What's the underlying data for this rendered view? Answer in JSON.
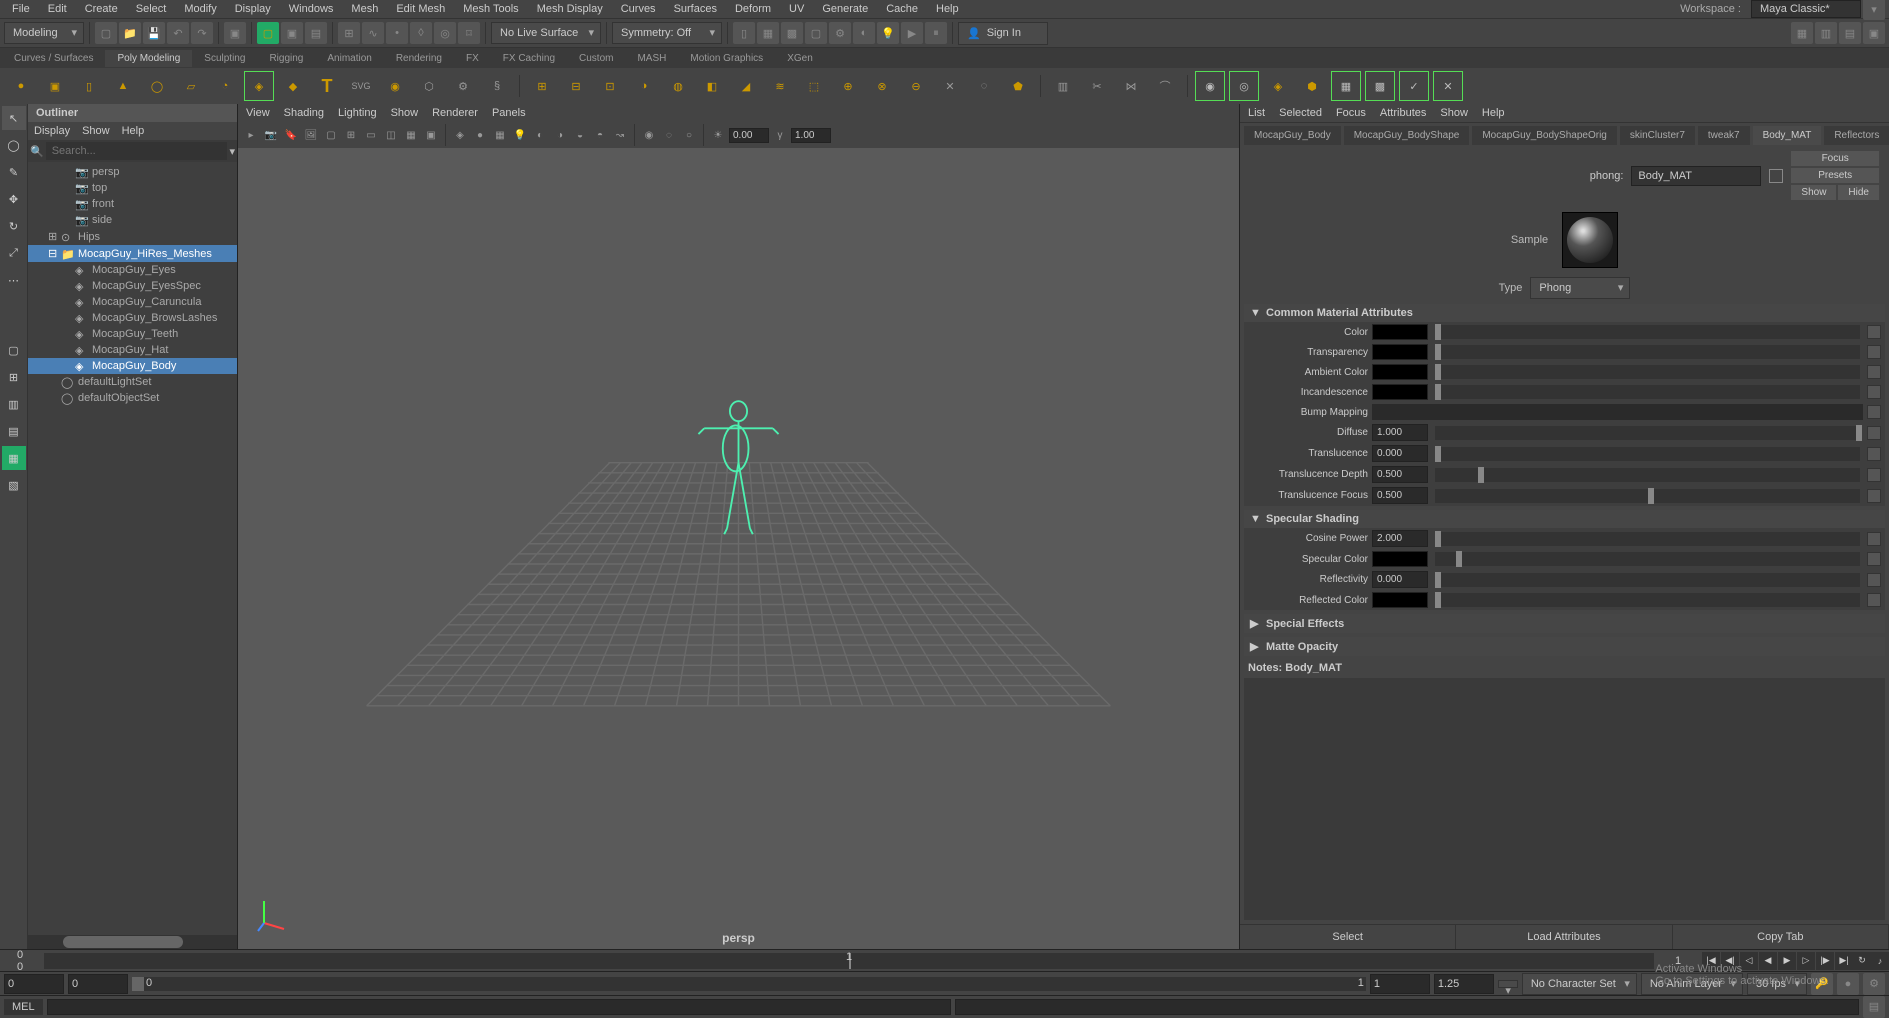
{
  "menubar": {
    "items": [
      "File",
      "Edit",
      "Create",
      "Select",
      "Modify",
      "Display",
      "Windows",
      "Mesh",
      "Edit Mesh",
      "Mesh Tools",
      "Mesh Display",
      "Curves",
      "Surfaces",
      "Deform",
      "UV",
      "Generate",
      "Cache",
      "Help"
    ],
    "workspace_label": "Workspace :",
    "workspace_value": "Maya Classic*"
  },
  "toolbar1": {
    "mode": "Modeling",
    "no_live": "No Live Surface",
    "symmetry": "Symmetry: Off",
    "signin": "Sign In"
  },
  "shelf_tabs": [
    "Curves / Surfaces",
    "Poly Modeling",
    "Sculpting",
    "Rigging",
    "Animation",
    "Rendering",
    "FX",
    "FX Caching",
    "Custom",
    "MASH",
    "Motion Graphics",
    "XGen"
  ],
  "shelf_active": "Poly Modeling",
  "outliner": {
    "title": "Outliner",
    "menu": [
      "Display",
      "Show",
      "Help"
    ],
    "search_placeholder": "Search...",
    "items": [
      {
        "label": "persp",
        "icon": "cam",
        "indent": 2
      },
      {
        "label": "top",
        "icon": "cam",
        "indent": 2
      },
      {
        "label": "front",
        "icon": "cam",
        "indent": 2
      },
      {
        "label": "side",
        "icon": "cam",
        "indent": 2
      },
      {
        "label": "Hips",
        "icon": "joint",
        "indent": 1,
        "exp": "+"
      },
      {
        "label": "MocapGuy_HiRes_Meshes",
        "icon": "grp",
        "indent": 1,
        "exp": "-",
        "sel": true
      },
      {
        "label": "MocapGuy_Eyes",
        "icon": "mesh",
        "indent": 2
      },
      {
        "label": "MocapGuy_EyesSpec",
        "icon": "mesh",
        "indent": 2
      },
      {
        "label": "MocapGuy_Caruncula",
        "icon": "mesh",
        "indent": 2
      },
      {
        "label": "MocapGuy_BrowsLashes",
        "icon": "mesh",
        "indent": 2
      },
      {
        "label": "MocapGuy_Teeth",
        "icon": "mesh",
        "indent": 2
      },
      {
        "label": "MocapGuy_Hat",
        "icon": "mesh",
        "indent": 2
      },
      {
        "label": "MocapGuy_Body",
        "icon": "mesh",
        "indent": 2,
        "sel": true
      },
      {
        "label": "defaultLightSet",
        "icon": "set",
        "indent": 1
      },
      {
        "label": "defaultObjectSet",
        "icon": "set",
        "indent": 1
      }
    ]
  },
  "viewport": {
    "menu": [
      "View",
      "Shading",
      "Lighting",
      "Show",
      "Renderer",
      "Panels"
    ],
    "focal_num": "0.00",
    "focal_num2": "1.00",
    "camera": "persp"
  },
  "attr": {
    "menu": [
      "List",
      "Selected",
      "Focus",
      "Attributes",
      "Show",
      "Help"
    ],
    "tabs": [
      "MocapGuy_Body",
      "MocapGuy_BodyShape",
      "MocapGuy_BodyShapeOrig",
      "skinCluster7",
      "tweak7",
      "Body_MAT",
      "Reflectors"
    ],
    "active_tab": "Body_MAT",
    "focus": "Focus",
    "presets": "Presets",
    "show": "Show",
    "hide": "Hide",
    "node_type": "phong:",
    "node_name": "Body_MAT",
    "sample": "Sample",
    "type_label": "Type",
    "type_value": "Phong",
    "sections": {
      "common": {
        "title": "Common Material Attributes",
        "rows": [
          {
            "label": "Color",
            "kind": "swatch",
            "color": "#000"
          },
          {
            "label": "Transparency",
            "kind": "swatch",
            "color": "#000"
          },
          {
            "label": "Ambient Color",
            "kind": "swatch",
            "color": "#000"
          },
          {
            "label": "Incandescence",
            "kind": "swatch",
            "color": "#000"
          },
          {
            "label": "Bump Mapping",
            "kind": "map"
          },
          {
            "label": "Diffuse",
            "kind": "num",
            "value": "1.000",
            "pos": 99
          },
          {
            "label": "Translucence",
            "kind": "num",
            "value": "0.000",
            "pos": 0
          },
          {
            "label": "Translucence Depth",
            "kind": "num",
            "value": "0.500",
            "pos": 10
          },
          {
            "label": "Translucence Focus",
            "kind": "num",
            "value": "0.500",
            "pos": 50
          }
        ]
      },
      "specular": {
        "title": "Specular Shading",
        "rows": [
          {
            "label": "Cosine Power",
            "kind": "num",
            "value": "2.000",
            "pos": 0
          },
          {
            "label": "Specular Color",
            "kind": "swatch",
            "color": "#000",
            "pos": 5
          },
          {
            "label": "Reflectivity",
            "kind": "num",
            "value": "0.000",
            "pos": 0
          },
          {
            "label": "Reflected Color",
            "kind": "swatch",
            "color": "#000"
          }
        ]
      },
      "fx": {
        "title": "Special Effects"
      },
      "matte": {
        "title": "Matte Opacity"
      }
    },
    "notes_label": "Notes: Body_MAT",
    "bottom": [
      "Select",
      "Load Attributes",
      "Copy Tab"
    ]
  },
  "timeline": {
    "start": "0",
    "cur_a": "1",
    "cur_b": "1",
    "end": "1"
  },
  "range": {
    "r1": "0",
    "r2": "0",
    "cur": "1",
    "r3": "1.25",
    "charset": "No Character Set",
    "animlayer": "No Anim Layer",
    "fps": "30 fps"
  },
  "cmd": {
    "lang": "MEL"
  },
  "watermark": {
    "t1": "Activate Windows",
    "t2": "Go to Settings to activate Windows."
  }
}
